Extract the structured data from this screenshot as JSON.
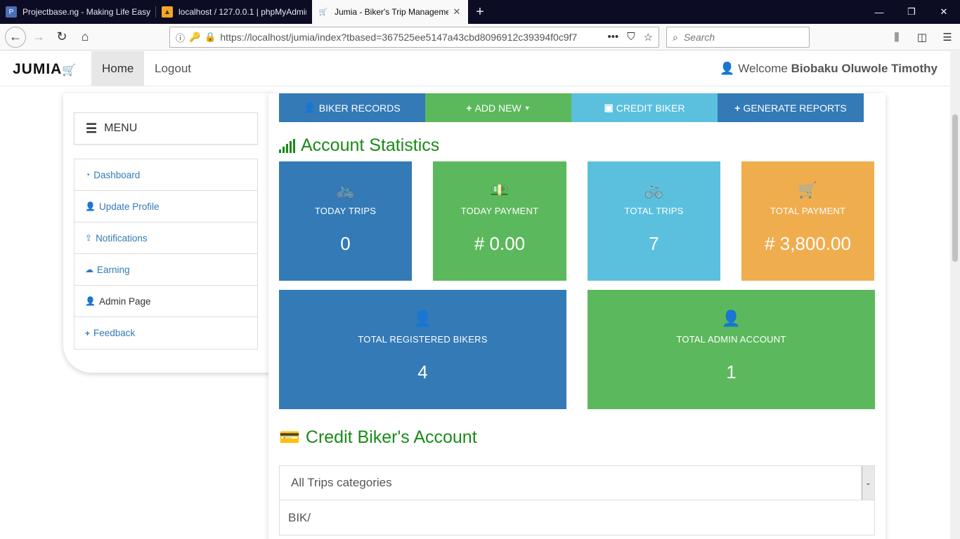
{
  "browser": {
    "tabs": [
      {
        "title": "Projectbase.ng - Making Life Easy b",
        "icon": "site-icon"
      },
      {
        "title": "localhost / 127.0.0.1 | phpMyAdmin",
        "icon": "phpmyadmin-icon"
      },
      {
        "title": "Jumia - Biker's Trip Manageme",
        "icon": "cart-icon",
        "active": true
      }
    ],
    "url": "https://localhost/jumia/index?tbased=367525ee5147a43cbd8096912c39394f0c9f7",
    "search_placeholder": "Search"
  },
  "nav": {
    "brand": "JUMIA",
    "home": "Home",
    "logout": "Logout",
    "welcome_prefix": "Welcome ",
    "user_name": "Biobaku Oluwole Timothy"
  },
  "sidebar": {
    "menu_label": "MENU",
    "items": [
      {
        "label": "Dashboard",
        "icon": "dashboard-icon"
      },
      {
        "label": "Update Profile",
        "icon": "user-icon"
      },
      {
        "label": "Notifications",
        "icon": "upload-icon"
      },
      {
        "label": "Earning",
        "icon": "cloud-upload-icon"
      },
      {
        "label": "Admin Page",
        "icon": "user-icon"
      },
      {
        "label": "Feedback",
        "icon": "plus-icon"
      }
    ]
  },
  "actions": {
    "biker_records": "BIKER RECORDS",
    "add_new": "ADD NEW",
    "credit_biker": "CREDIT BIKER",
    "generate_reports": "GENERATE REPORTS"
  },
  "stats": {
    "title": "Account Statistics",
    "today_trips": {
      "label": "TODAY TRIPS",
      "value": "0"
    },
    "today_payment": {
      "label": "TODAY PAYMENT",
      "value": "# 0.00"
    },
    "total_trips": {
      "label": "TOTAL TRIPS",
      "value": "7"
    },
    "total_payment": {
      "label": "TOTAL PAYMENT",
      "value": "# 3,800.00"
    },
    "registered_bikers": {
      "label": "TOTAL REGISTERED BIKERS",
      "value": "4"
    },
    "admin_account": {
      "label": "TOTAL ADMIN ACCOUNT",
      "value": "1"
    }
  },
  "credit": {
    "title": "Credit Biker's Account",
    "select_value": "All Trips categories",
    "row_text": "BIK/"
  },
  "colors": {
    "primary": "#337ab7",
    "success": "#5cb85c",
    "info": "#5bc0de",
    "warning": "#f0ad4e",
    "title_green": "#1a8a1a"
  }
}
